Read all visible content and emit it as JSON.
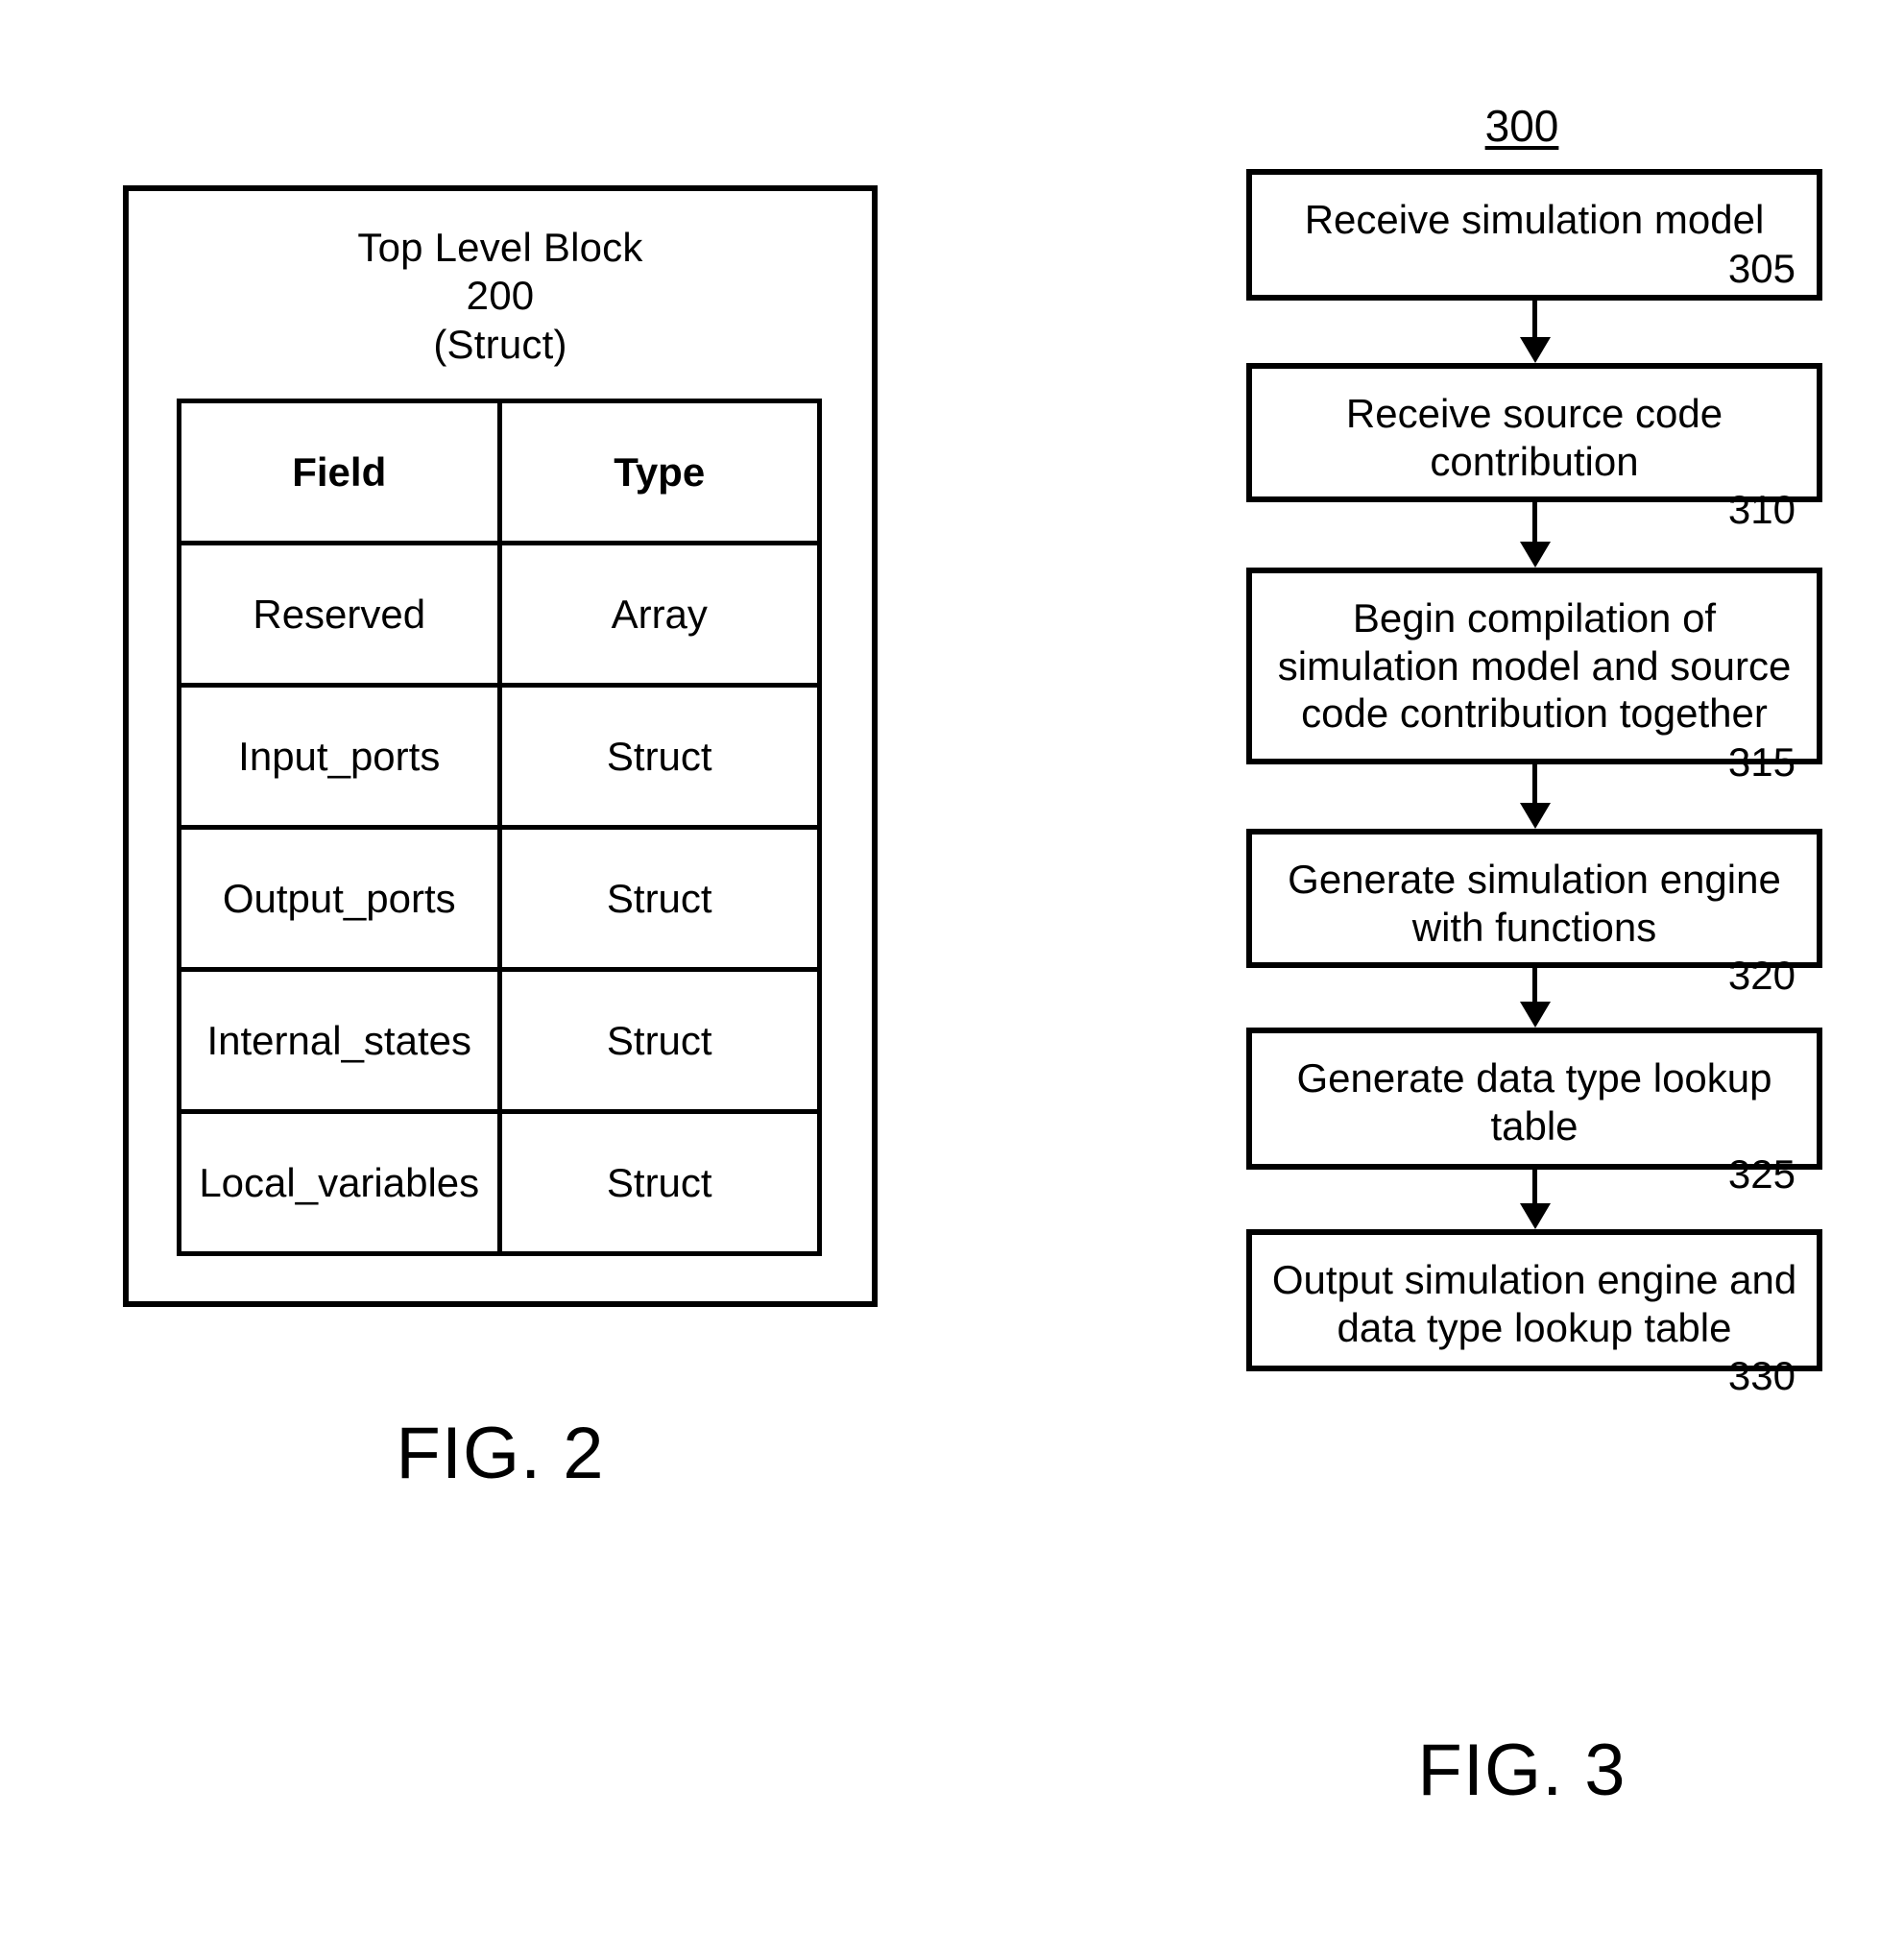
{
  "figure2": {
    "caption": "FIG. 2",
    "block": {
      "title": "Top Level Block",
      "ref": "200",
      "kind": "(Struct)"
    },
    "table": {
      "headers": [
        "Field",
        "Type"
      ],
      "rows": [
        {
          "field": "Reserved",
          "type": "Array"
        },
        {
          "field": "Input_ports",
          "type": "Struct"
        },
        {
          "field": "Output_ports",
          "type": "Struct"
        },
        {
          "field": "Internal_states",
          "type": "Struct"
        },
        {
          "field": "Local_variables",
          "type": "Struct"
        }
      ]
    }
  },
  "figure3": {
    "caption": "FIG. 3",
    "ref": "300",
    "steps": [
      {
        "text_lines": [
          "Receive simulation model"
        ],
        "number": "305"
      },
      {
        "text_lines": [
          "Receive source code",
          "contribution"
        ],
        "number": "310"
      },
      {
        "text_lines": [
          "Begin compilation of",
          "simulation model and source",
          "code contribution together"
        ],
        "number": "315"
      },
      {
        "text_lines": [
          "Generate simulation engine",
          "with functions"
        ],
        "number": "320"
      },
      {
        "text_lines": [
          "Generate data type lookup",
          "table"
        ],
        "number": "325"
      },
      {
        "text_lines": [
          "Output simulation engine and",
          "data type lookup table"
        ],
        "number": "330"
      }
    ],
    "connector_count": 5
  },
  "colors": {
    "ink": "#000000",
    "paper": "#ffffff"
  }
}
